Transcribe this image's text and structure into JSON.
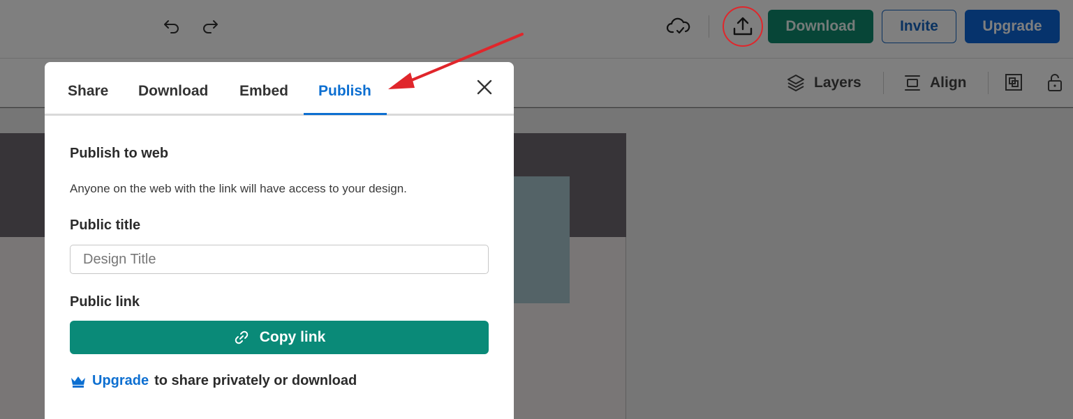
{
  "toolbar": {
    "download_label": "Download",
    "invite_label": "Invite",
    "upgrade_label": "Upgrade",
    "layers_label": "Layers",
    "align_label": "Align"
  },
  "icons": {
    "undo": "undo-icon",
    "redo": "redo-icon",
    "cloud": "cloud-check-icon",
    "upload": "upload-icon",
    "layers": "layers-icon",
    "align": "align-icon",
    "group": "group-icon",
    "lock": "lock-icon",
    "close": "close-icon",
    "link": "link-icon",
    "crown": "crown-icon"
  },
  "modal": {
    "tabs": [
      {
        "label": "Share"
      },
      {
        "label": "Download"
      },
      {
        "label": "Embed"
      },
      {
        "label": "Publish",
        "active": true
      }
    ],
    "heading": "Publish to web",
    "description": "Anyone on the web with the link will have access to your design.",
    "public_title_label": "Public title",
    "title_placeholder": "Design Title",
    "public_link_label": "Public link",
    "copy_link_label": "Copy link",
    "upgrade_link": "Upgrade",
    "upgrade_rest": "to share privately or download"
  },
  "colors": {
    "accent_blue": "#0d6fd1",
    "green": "#0a8a78",
    "annotation_red": "#e0262b"
  }
}
